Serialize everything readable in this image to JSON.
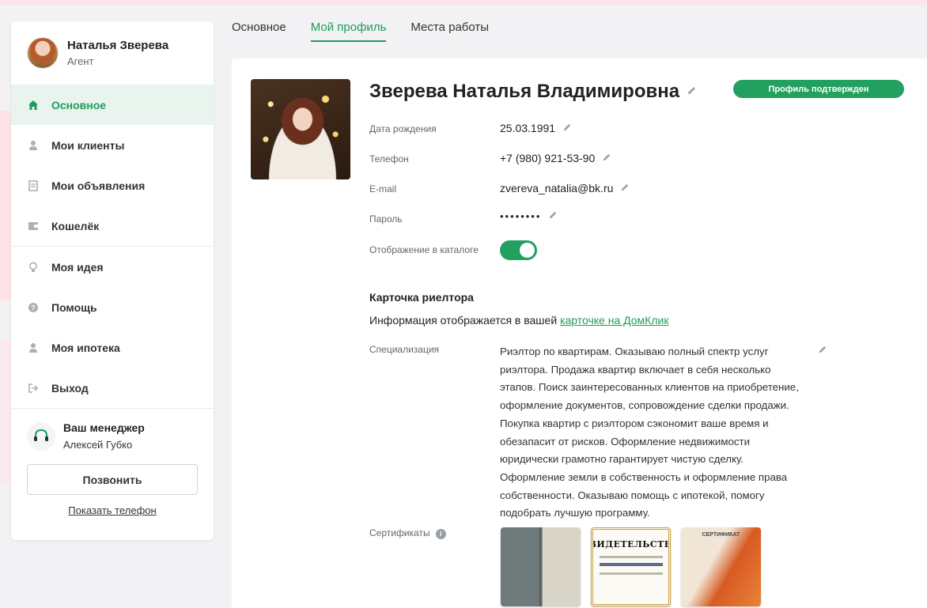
{
  "user": {
    "name": "Наталья Зверева",
    "role": "Агент"
  },
  "sidebar": {
    "items": [
      {
        "label": "Основное",
        "icon": "home-icon",
        "active": true
      },
      {
        "label": "Мои клиенты",
        "icon": "person-icon"
      },
      {
        "label": "Мои объявления",
        "icon": "list-icon"
      },
      {
        "label": "Кошелёк",
        "icon": "wallet-icon"
      },
      {
        "label": "Моя идея",
        "icon": "lightbulb-icon"
      },
      {
        "label": "Помощь",
        "icon": "help-icon"
      },
      {
        "label": "Моя ипотека",
        "icon": "person-icon"
      },
      {
        "label": "Выход",
        "icon": "logout-icon"
      }
    ]
  },
  "manager": {
    "title": "Ваш менеджер",
    "name": "Алексей Губко",
    "call_label": "Позвонить",
    "show_phone_label": "Показать телефон"
  },
  "tabs": [
    {
      "label": "Основное",
      "active": false
    },
    {
      "label": "Мой профиль",
      "active": true
    },
    {
      "label": "Места работы",
      "active": false
    }
  ],
  "profile": {
    "full_name": "Зверева Наталья Владимировна",
    "badge": "Профиль подтвержден",
    "fields": {
      "birth_label": "Дата рождения",
      "birth_value": "25.03.1991",
      "phone_label": "Телефон",
      "phone_value": "+7 (980) 921-53-90",
      "email_label": "E-mail",
      "email_value": "zvereva_natalia@bk.ru",
      "password_label": "Пароль",
      "password_value": "••••••••",
      "catalog_label": "Отображение в каталоге"
    },
    "catalog_visible": true
  },
  "realtor_card": {
    "title": "Карточка риелтора",
    "info_prefix": "Информация отображается в вашей ",
    "info_link": "карточке на ДомКлик",
    "specialization_label": "Специализация",
    "specialization_text": "Риэлтор по квартирам. Оказываю полный спектр услуг риэлтора. Продажа квартир включает в себя несколько этапов. Поиск заинтересованных клиентов на приобретение, оформление документов, сопровождение сделки продажи. Покупка квартир с риэлтором сэкономит ваше время и обезапасит от рисков. Оформление недвижимости юридически грамотно гарантирует чистую сделку. Оформление земли в собственность и оформление права собственности. Оказываю помощь с ипотекой, помогу подобрать лучшую программу.",
    "certificates_label": "Сертификаты",
    "certificate_titles": [
      "СВИДЕТЕЛЬСТВО",
      "СЕРТИФИКАТ"
    ]
  },
  "colors": {
    "accent": "#1e9c5b",
    "badge": "#21a060",
    "active_bg": "#e8f4ed"
  }
}
